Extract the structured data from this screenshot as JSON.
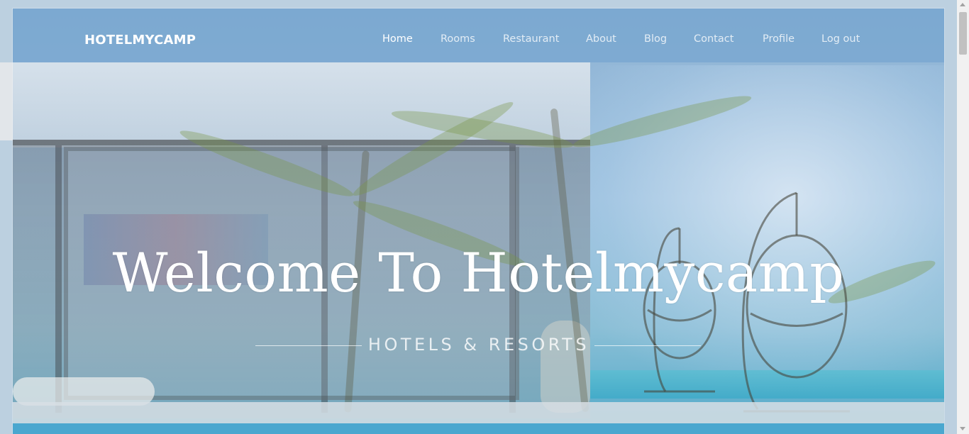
{
  "header": {
    "logo": "HOTELMYCAMP"
  },
  "nav": {
    "items": [
      {
        "label": "Home",
        "active": true
      },
      {
        "label": "Rooms",
        "active": false
      },
      {
        "label": "Restaurant",
        "active": false
      },
      {
        "label": "About",
        "active": false
      },
      {
        "label": "Blog",
        "active": false
      },
      {
        "label": "Contact",
        "active": false
      },
      {
        "label": "Profile",
        "active": false
      },
      {
        "label": "Log out",
        "active": false
      }
    ]
  },
  "hero": {
    "title": "Welcome To Hotelmycamp",
    "subtitle": "HOTELS & RESORTS"
  },
  "colors": {
    "header_overlay": "#6ea0cd",
    "text": "#ffffff",
    "pool": "#4aa7cf"
  },
  "icons": {
    "scroll_up": "scroll-up-arrow-icon",
    "scroll_down": "scroll-down-arrow-icon"
  }
}
